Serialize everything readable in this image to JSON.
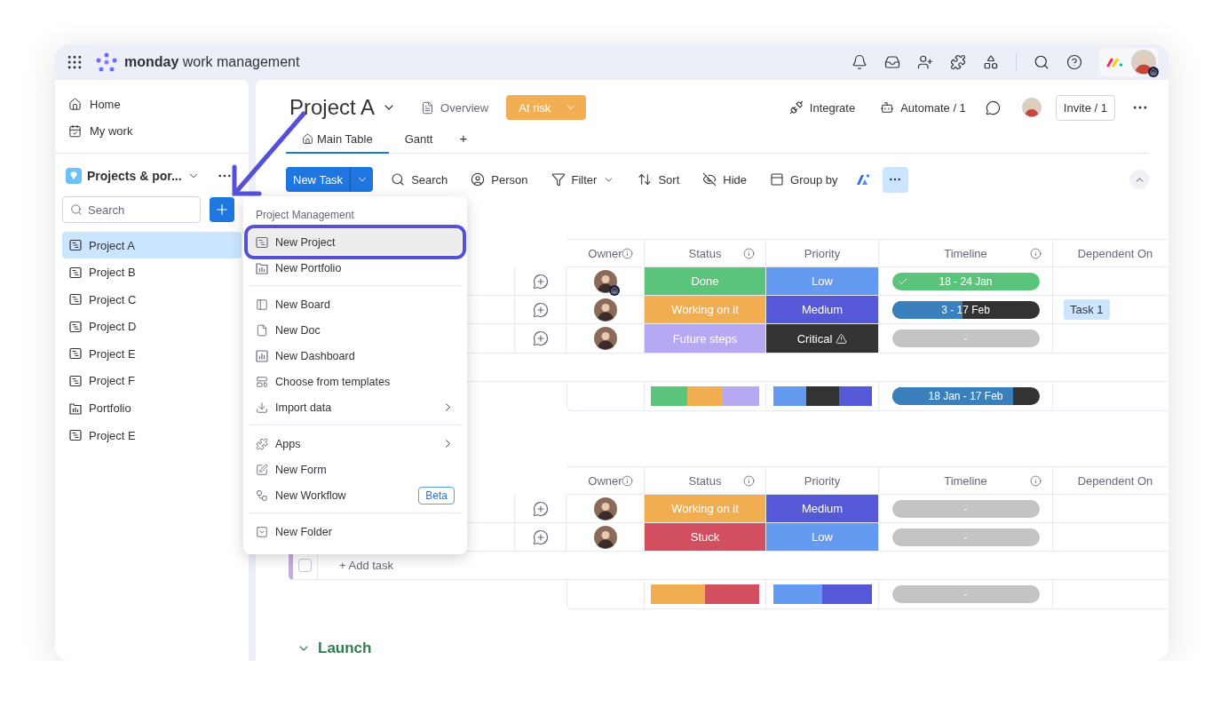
{
  "topbar": {
    "brand": "monday",
    "product": "work management"
  },
  "sidebar": {
    "nav": [
      {
        "label": "Home",
        "kind": "home"
      },
      {
        "label": "My work",
        "kind": "mywork"
      }
    ],
    "workspace": "Projects & por...",
    "search": {
      "placeholder": "Search"
    },
    "items": [
      {
        "label": "Project A",
        "kind": "project",
        "selected": true
      },
      {
        "label": "Project B",
        "kind": "project",
        "selected": false
      },
      {
        "label": "Project C",
        "kind": "project",
        "selected": false
      },
      {
        "label": "Project D",
        "kind": "project",
        "selected": false
      },
      {
        "label": "Project E",
        "kind": "project",
        "selected": false
      },
      {
        "label": "Project F",
        "kind": "project",
        "selected": false
      },
      {
        "label": "Portfolio",
        "kind": "portfolio",
        "selected": false
      },
      {
        "label": "Project E",
        "kind": "project",
        "selected": false
      }
    ]
  },
  "header": {
    "title": "Project A",
    "overview": "Overview",
    "health": {
      "label": "At risk",
      "color": "#f2ae52"
    },
    "integrate": "Integrate",
    "automate": "Automate / 1",
    "invite": "Invite / 1"
  },
  "tabs": [
    {
      "label": "Main Table",
      "selected": true
    },
    {
      "label": "Gantt",
      "selected": false
    }
  ],
  "add_tab": "+",
  "toolbar": {
    "new_task": "New Task",
    "items": [
      {
        "label": "Search",
        "kind": "search"
      },
      {
        "label": "Person",
        "kind": "person"
      },
      {
        "label": "Filter",
        "kind": "filter"
      },
      {
        "label": "Sort",
        "kind": "sort"
      },
      {
        "label": "Hide",
        "kind": "hide"
      },
      {
        "label": "Group by",
        "kind": "group"
      }
    ]
  },
  "menu": {
    "heading": "Project Management",
    "sections": [
      [
        {
          "label": "New Project",
          "kind": "project",
          "selected": true
        },
        {
          "label": "New Portfolio",
          "kind": "portfolio",
          "selected": false
        }
      ],
      [
        {
          "label": "New Board",
          "kind": "board",
          "selected": false
        },
        {
          "label": "New Doc",
          "kind": "doc",
          "selected": false
        },
        {
          "label": "New Dashboard",
          "kind": "dashboard",
          "selected": false
        },
        {
          "label": "Choose from templates",
          "kind": "templates",
          "selected": false
        },
        {
          "label": "Import data",
          "kind": "import",
          "selected": false,
          "submenu": true
        }
      ],
      [
        {
          "label": "Apps",
          "kind": "apps",
          "selected": false,
          "submenu": true
        },
        {
          "label": "New Form",
          "kind": "form",
          "selected": false
        },
        {
          "label": "New Workflow",
          "kind": "workflow",
          "selected": false,
          "badge": "Beta"
        }
      ],
      [
        {
          "label": "New Folder",
          "kind": "folder",
          "selected": false
        }
      ]
    ]
  },
  "groups": [
    {
      "columns": [
        {
          "label": "Owner",
          "info": true
        },
        {
          "label": "Status",
          "info": true
        },
        {
          "label": "Priority",
          "info": false
        },
        {
          "label": "Timeline",
          "info": true
        },
        {
          "label": "Dependent On",
          "info": false
        }
      ],
      "rows": [
        {
          "owner_home": true,
          "status": {
            "label": "Done",
            "color": "#5bc47b"
          },
          "priority": {
            "label": "Low",
            "color": "#659af1"
          },
          "timeline": {
            "label": "18 - 24 Jan",
            "color": "#5bc47b",
            "level": 1,
            "checked": true
          }
        },
        {
          "owner_home": false,
          "status": {
            "label": "Working on it",
            "color": "#f1ae51"
          },
          "priority": {
            "label": "Medium",
            "color": "#5559d8"
          },
          "timeline": {
            "label": "3 - 17 Feb",
            "color": "#3a80bd",
            "level": 0.48,
            "checked": false
          },
          "dependent": "Task 1"
        },
        {
          "owner_home": false,
          "status": {
            "label": "Future steps",
            "color": "#b6a8f2"
          },
          "priority": {
            "label": "Critical",
            "color": "#333333",
            "warning": true
          },
          "timeline": {
            "label": "-",
            "color": "#c4c4c4",
            "level": 1,
            "checked": false
          }
        }
      ],
      "summary": {
        "status": [
          {
            "color": "#5bc47b"
          },
          {
            "color": "#f1ae51"
          },
          {
            "color": "#b6a8f2"
          }
        ],
        "priority": [
          {
            "color": "#659af1"
          },
          {
            "color": "#333333"
          },
          {
            "color": "#5559d8"
          }
        ],
        "timeline": {
          "label": "18 Jan - 17 Feb",
          "color": "#3a80bd",
          "level": 0.82,
          "checked": false
        }
      }
    },
    {
      "color": "#c7a8ea",
      "add_task": "+ Add task",
      "add_checked": false,
      "columns": [
        {
          "label": "Owner",
          "info": true
        },
        {
          "label": "Status",
          "info": true
        },
        {
          "label": "Priority",
          "info": false
        },
        {
          "label": "Timeline",
          "info": true
        },
        {
          "label": "Dependent On",
          "info": false
        }
      ],
      "rows": [
        {
          "owner_home": false,
          "status": {
            "label": "Working on it",
            "color": "#f1ae51"
          },
          "priority": {
            "label": "Medium",
            "color": "#5559d8"
          },
          "timeline": {
            "label": "-",
            "color": "#c4c4c4",
            "level": 1,
            "checked": false
          }
        },
        {
          "owner_home": false,
          "status": {
            "label": "Stuck",
            "color": "#d24f5f"
          },
          "priority": {
            "label": "Low",
            "color": "#659af1"
          },
          "timeline": {
            "label": "-",
            "color": "#c4c4c4",
            "level": 1,
            "checked": false
          }
        }
      ],
      "summary": {
        "status": [
          {
            "color": "#f1ae51"
          },
          {
            "color": "#d24f5f"
          }
        ],
        "priority": [
          {
            "color": "#659af1"
          },
          {
            "color": "#5559d8"
          }
        ],
        "timeline": {
          "label": "-",
          "color": "#c4c4c4",
          "level": 1,
          "checked": false
        }
      }
    }
  ],
  "next_group": {
    "title": "Launch",
    "color": "#2e7d4f"
  }
}
